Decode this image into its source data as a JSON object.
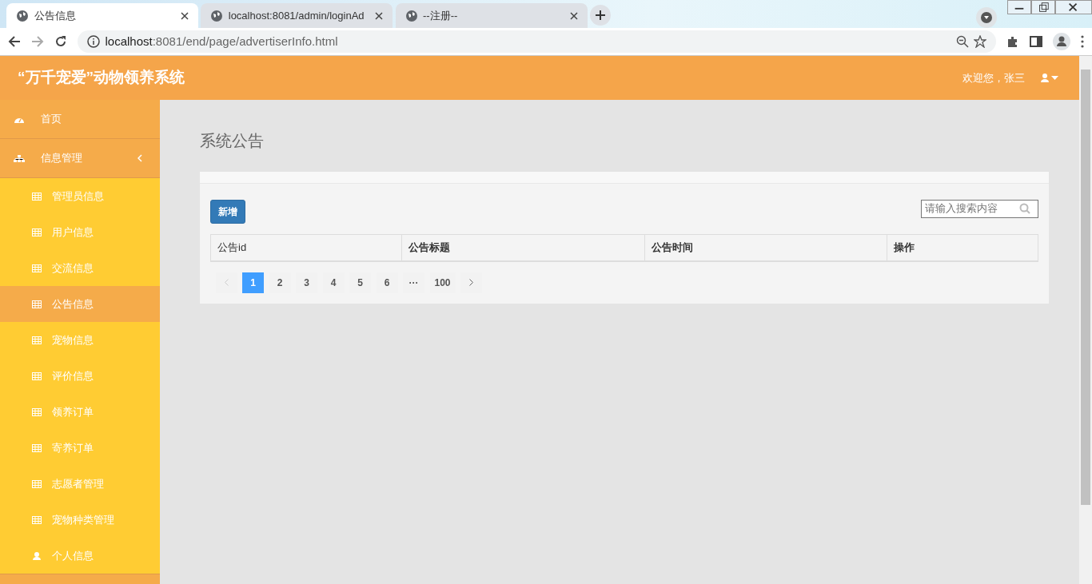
{
  "browser": {
    "tabs": [
      {
        "title": "公告信息",
        "selected": true
      },
      {
        "title": "localhost:8081/admin/loginAd",
        "selected": false
      },
      {
        "title": "--注册--",
        "selected": false
      }
    ],
    "url_host": "localhost",
    "url_path": ":8081/end/page/advertiserInfo.html"
  },
  "header": {
    "title": "“万千宠爱”动物领养系统",
    "greeting": "欢迎您，张三"
  },
  "sidebar": {
    "items": [
      {
        "label": "首页",
        "kind": "home"
      },
      {
        "label": "信息管理",
        "kind": "group",
        "expanded": true,
        "children": [
          {
            "label": "管理员信息",
            "kind": "page",
            "selected": false
          },
          {
            "label": "用户信息",
            "kind": "page",
            "selected": false
          },
          {
            "label": "交流信息",
            "kind": "page",
            "selected": false
          },
          {
            "label": "公告信息",
            "kind": "page",
            "selected": true
          },
          {
            "label": "宠物信息",
            "kind": "page",
            "selected": false
          },
          {
            "label": "评价信息",
            "kind": "page",
            "selected": false
          },
          {
            "label": "领养订单",
            "kind": "page",
            "selected": false
          },
          {
            "label": "寄养订单",
            "kind": "page",
            "selected": false
          },
          {
            "label": "志愿者管理",
            "kind": "page",
            "selected": false
          },
          {
            "label": "宠物种类管理",
            "kind": "page",
            "selected": false
          },
          {
            "label": "个人信息",
            "kind": "profile",
            "selected": false
          }
        ]
      }
    ]
  },
  "main": {
    "title": "系统公告",
    "add_button": "新增",
    "search": {
      "placeholder": "请输入搜索内容"
    },
    "table": {
      "columns": [
        "公告id",
        "公告标题",
        "公告时间",
        "操作"
      ]
    },
    "pagination": {
      "prev_disabled": true,
      "next_disabled": false,
      "pages": [
        {
          "label": "1",
          "selected": true
        },
        {
          "label": "2",
          "selected": false
        },
        {
          "label": "3",
          "selected": false
        },
        {
          "label": "4",
          "selected": false
        },
        {
          "label": "5",
          "selected": false
        },
        {
          "label": "6",
          "selected": false
        },
        {
          "label": "···",
          "selected": false
        },
        {
          "label": "100",
          "selected": false
        }
      ]
    }
  }
}
